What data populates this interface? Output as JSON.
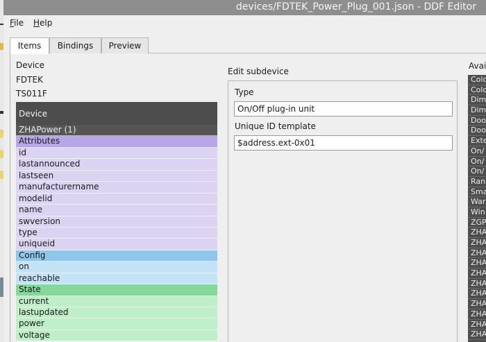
{
  "window": {
    "title": "devices/FDTEK_Power_Plug_001.json - DDF Editor"
  },
  "menu": [
    "File",
    "Help"
  ],
  "tabs": [
    "Items",
    "Bindings",
    "Preview"
  ],
  "device": {
    "heading": "Device",
    "manufacturer": "FDTEK",
    "model": "TS011F"
  },
  "tree": {
    "header": "Device",
    "rows": [
      {
        "label": "ZHAPower (1)",
        "kind": "sub"
      },
      {
        "label": "Attributes",
        "kind": "attr-h"
      },
      {
        "label": "id",
        "kind": "attr"
      },
      {
        "label": "lastannounced",
        "kind": "attr"
      },
      {
        "label": "lastseen",
        "kind": "attr"
      },
      {
        "label": "manufacturername",
        "kind": "attr"
      },
      {
        "label": "modelid",
        "kind": "attr"
      },
      {
        "label": "name",
        "kind": "attr"
      },
      {
        "label": "swversion",
        "kind": "attr"
      },
      {
        "label": "type",
        "kind": "attr"
      },
      {
        "label": "uniqueid",
        "kind": "attr"
      },
      {
        "label": "Config",
        "kind": "cfg-h"
      },
      {
        "label": "on",
        "kind": "cfg"
      },
      {
        "label": "reachable",
        "kind": "cfg"
      },
      {
        "label": "State",
        "kind": "st-h"
      },
      {
        "label": "current",
        "kind": "st"
      },
      {
        "label": "lastupdated",
        "kind": "st"
      },
      {
        "label": "power",
        "kind": "st"
      },
      {
        "label": "voltage",
        "kind": "st"
      }
    ]
  },
  "edit": {
    "title": "Edit subdevice",
    "type_label": "Type",
    "type_value": "On/Off plug-in unit",
    "uid_label": "Unique ID template",
    "uid_value": "$address.ext-0x01"
  },
  "available": {
    "title": "Avai",
    "items": [
      "Colo",
      "Colo",
      "Dim",
      "Dim",
      "Doo",
      "Doo",
      "Exte",
      "On/",
      "On/",
      "On/",
      "Ran",
      "Sma",
      "War",
      "Win",
      "ZGP",
      "ZHA",
      "ZHA",
      "ZHA",
      "ZHA",
      "ZHA",
      "ZHA",
      "ZHA",
      "ZHA",
      "ZHA",
      "ZHA",
      "ZHA"
    ]
  }
}
